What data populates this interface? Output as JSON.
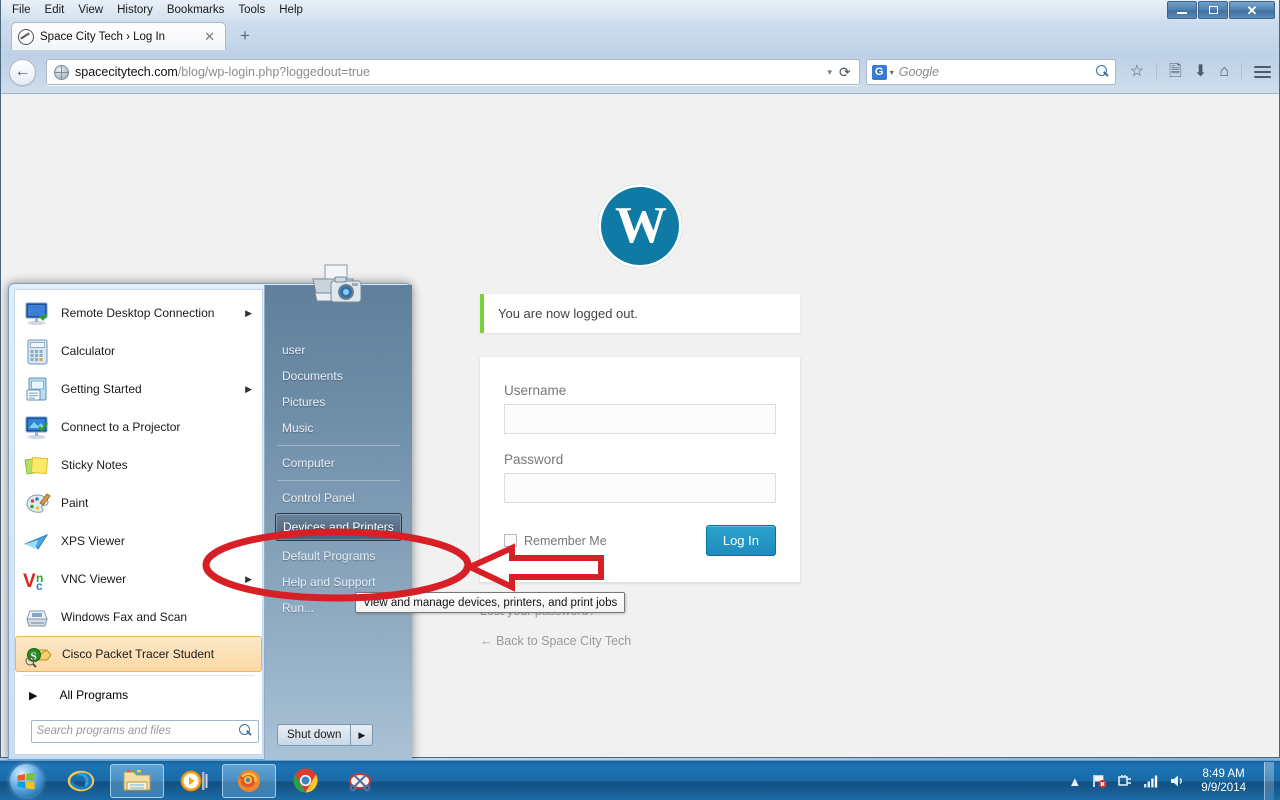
{
  "browser": {
    "menubar": [
      "File",
      "Edit",
      "View",
      "History",
      "Bookmarks",
      "Tools",
      "Help"
    ],
    "window_controls": {
      "minimize": "–",
      "restore": "❐",
      "close": "✕"
    },
    "tab": {
      "title": "Space City Tech › Log In",
      "close": "✕",
      "favicon": "wordpress-favicon"
    },
    "new_tab_label": "+",
    "back_label": "←",
    "url": {
      "domain": "spacecitytech.com",
      "path": "/blog/wp-login.php?loggedout=true"
    },
    "url_dropdown": "▾",
    "reload_label": "⟳",
    "search": {
      "engine": "G",
      "engine_dropdown": "▾",
      "placeholder": "Google"
    },
    "nav_icons": [
      "bookmark-star-icon",
      "reading-list-icon",
      "downloads-icon",
      "home-icon",
      "menu-icon"
    ]
  },
  "page": {
    "logo_letter": "W",
    "notice": "You are now logged out.",
    "form": {
      "username_label": "Username",
      "username_value": "",
      "password_label": "Password",
      "password_value": "",
      "remember_label": "Remember Me",
      "login_button": "Log In"
    },
    "links": [
      "Lost your password?",
      "← Back to Space City Tech"
    ]
  },
  "start_menu": {
    "programs": [
      {
        "label": "Remote Desktop Connection",
        "icon": "remote-desktop-icon",
        "has_submenu": true,
        "selected": false
      },
      {
        "label": "Calculator",
        "icon": "calculator-icon",
        "has_submenu": false,
        "selected": false
      },
      {
        "label": "Getting Started",
        "icon": "getting-started-icon",
        "has_submenu": true,
        "selected": false
      },
      {
        "label": "Connect to a Projector",
        "icon": "projector-icon",
        "has_submenu": false,
        "selected": false
      },
      {
        "label": "Sticky Notes",
        "icon": "sticky-notes-icon",
        "has_submenu": false,
        "selected": false
      },
      {
        "label": "Paint",
        "icon": "paint-icon",
        "has_submenu": false,
        "selected": false
      },
      {
        "label": "XPS Viewer",
        "icon": "xps-viewer-icon",
        "has_submenu": false,
        "selected": false
      },
      {
        "label": "VNC Viewer",
        "icon": "vnc-viewer-icon",
        "has_submenu": true,
        "selected": false
      },
      {
        "label": "Windows Fax and Scan",
        "icon": "fax-scan-icon",
        "has_submenu": false,
        "selected": false
      },
      {
        "label": "Cisco Packet Tracer Student",
        "icon": "packet-tracer-icon",
        "has_submenu": false,
        "selected": true
      }
    ],
    "all_programs": "All Programs",
    "all_programs_arrow": "▶",
    "search_placeholder": "Search programs and files",
    "right_items": [
      {
        "label": "user",
        "style": "plain",
        "divider_after": false
      },
      {
        "label": "Documents",
        "style": "plain",
        "divider_after": false
      },
      {
        "label": "Pictures",
        "style": "plain",
        "divider_after": false
      },
      {
        "label": "Music",
        "style": "plain",
        "divider_after": true
      },
      {
        "label": "Computer",
        "style": "plain",
        "divider_after": true
      },
      {
        "label": "Control Panel",
        "style": "plain",
        "divider_after": false
      },
      {
        "label": "Devices and Printers",
        "style": "boxed",
        "divider_after": false
      },
      {
        "label": "Default Programs",
        "style": "plain",
        "divider_after": false
      },
      {
        "label": "Help and Support",
        "style": "plain",
        "divider_after": false
      },
      {
        "label": "Run...",
        "style": "plain",
        "divider_after": false
      }
    ],
    "shutdown": {
      "label": "Shut down",
      "arrow": "▶"
    },
    "avatar_icon": "devices-and-printers-icon"
  },
  "tooltip": {
    "text": "View and manage devices, printers, and print jobs"
  },
  "annotation": {
    "ellipse_color": "#d81f26",
    "arrow_color": "#d81f26",
    "arrow_fill": "#ffffff",
    "target": "Devices and Printers"
  },
  "taskbar": {
    "start_label": "start-orb",
    "buttons": [
      {
        "name": "internet-explorer-icon",
        "active": false
      },
      {
        "name": "windows-explorer-icon",
        "active": true
      },
      {
        "name": "windows-media-player-icon",
        "active": false
      },
      {
        "name": "firefox-icon",
        "active": true
      },
      {
        "name": "chrome-icon",
        "active": false
      },
      {
        "name": "snipping-tool-icon",
        "active": false
      }
    ],
    "tray_icons": [
      "show-hidden-icons-arrow",
      "action-center-flag-icon",
      "network-icon",
      "signal-bars-icon",
      "volume-icon"
    ],
    "clock_time": "8:49 AM",
    "clock_date": "9/9/2014"
  }
}
